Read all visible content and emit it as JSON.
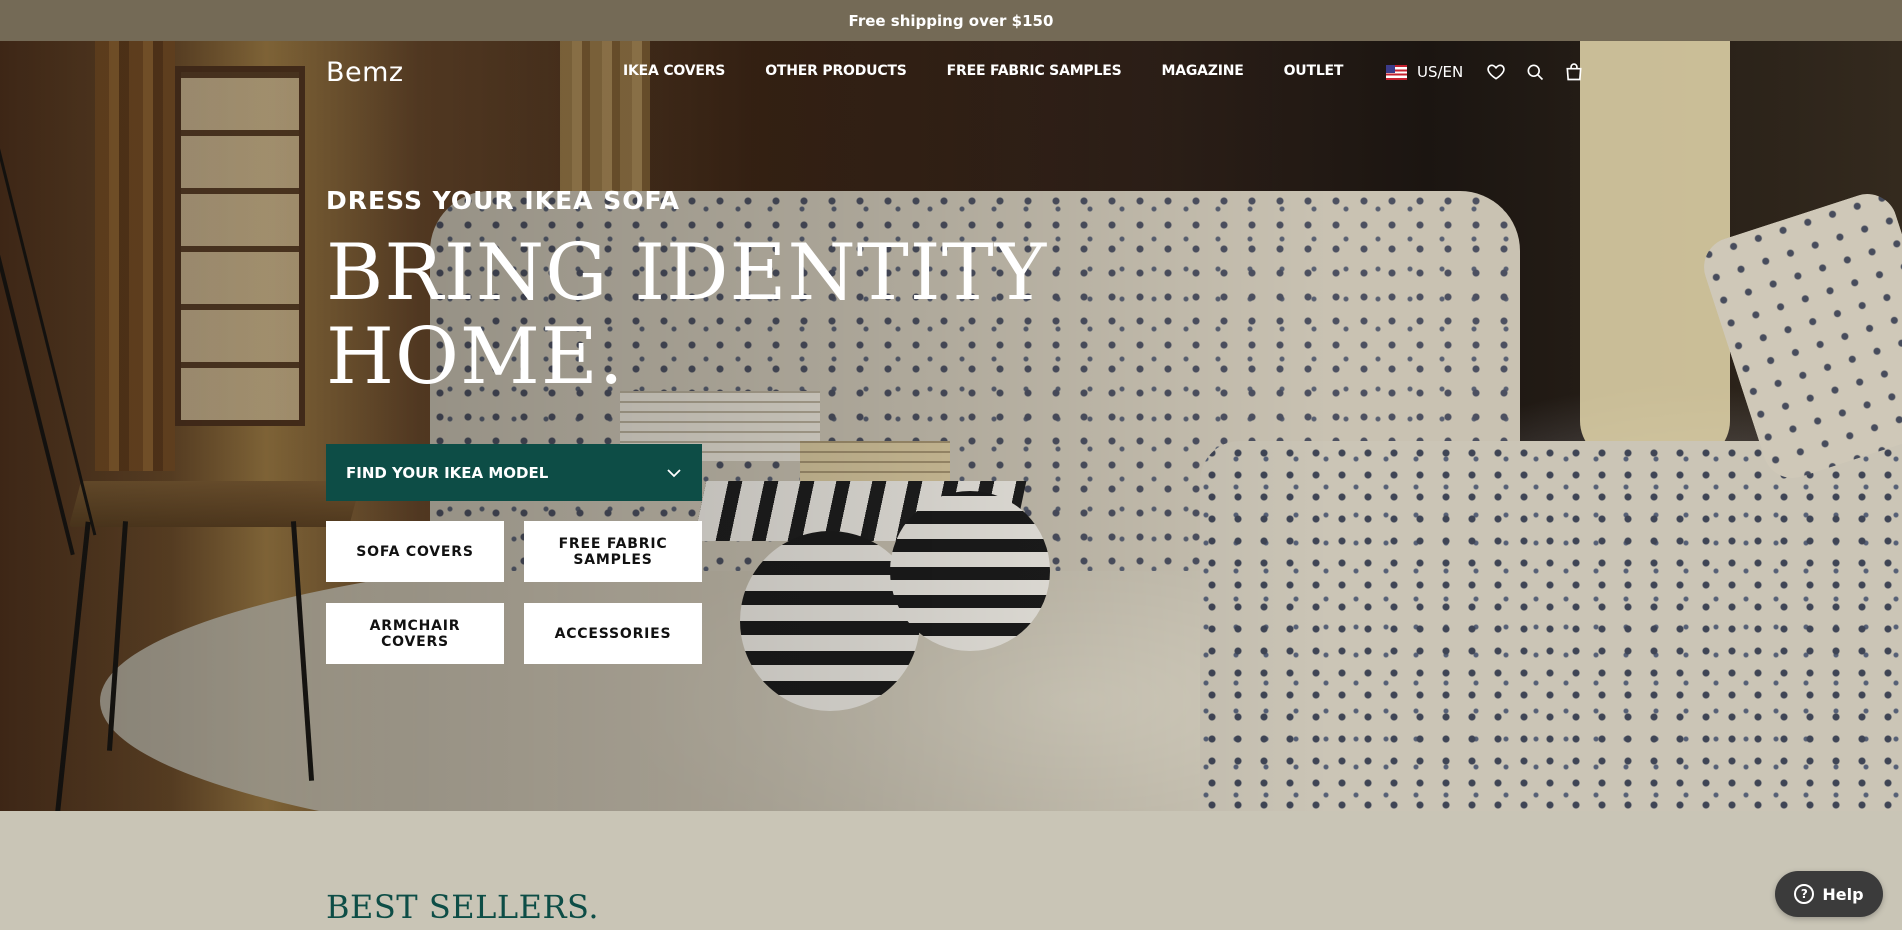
{
  "announcement": {
    "text": "Free shipping over $150"
  },
  "header": {
    "logo": "Bemz",
    "nav": [
      {
        "label": "IKEA COVERS"
      },
      {
        "label": "OTHER PRODUCTS"
      },
      {
        "label": "FREE FABRIC SAMPLES"
      },
      {
        "label": "MAGAZINE"
      },
      {
        "label": "OUTLET"
      }
    ],
    "locale": "US/EN",
    "icons": [
      "us-flag-icon",
      "heart-icon",
      "search-icon",
      "shopping-bag-icon"
    ]
  },
  "hero": {
    "eyebrow": "DRESS YOUR IKEA SOFA",
    "headline_line1": "BRING IDENTITY",
    "headline_line2": "HOME.",
    "model_select": {
      "label": "FIND YOUR IKEA MODEL",
      "icon": "chevron-down-icon"
    },
    "categories": [
      {
        "label": "SOFA COVERS"
      },
      {
        "label": "FREE FABRIC SAMPLES"
      },
      {
        "label": "ARMCHAIR COVERS"
      },
      {
        "label": "ACCESSORIES"
      }
    ]
  },
  "section": {
    "title": "BEST SELLERS."
  },
  "help": {
    "label": "Help",
    "icon": "question-icon"
  },
  "colors": {
    "announcement_bg": "#746a56",
    "accent": "#0d4d46",
    "page_bg": "#c9c5b6"
  }
}
